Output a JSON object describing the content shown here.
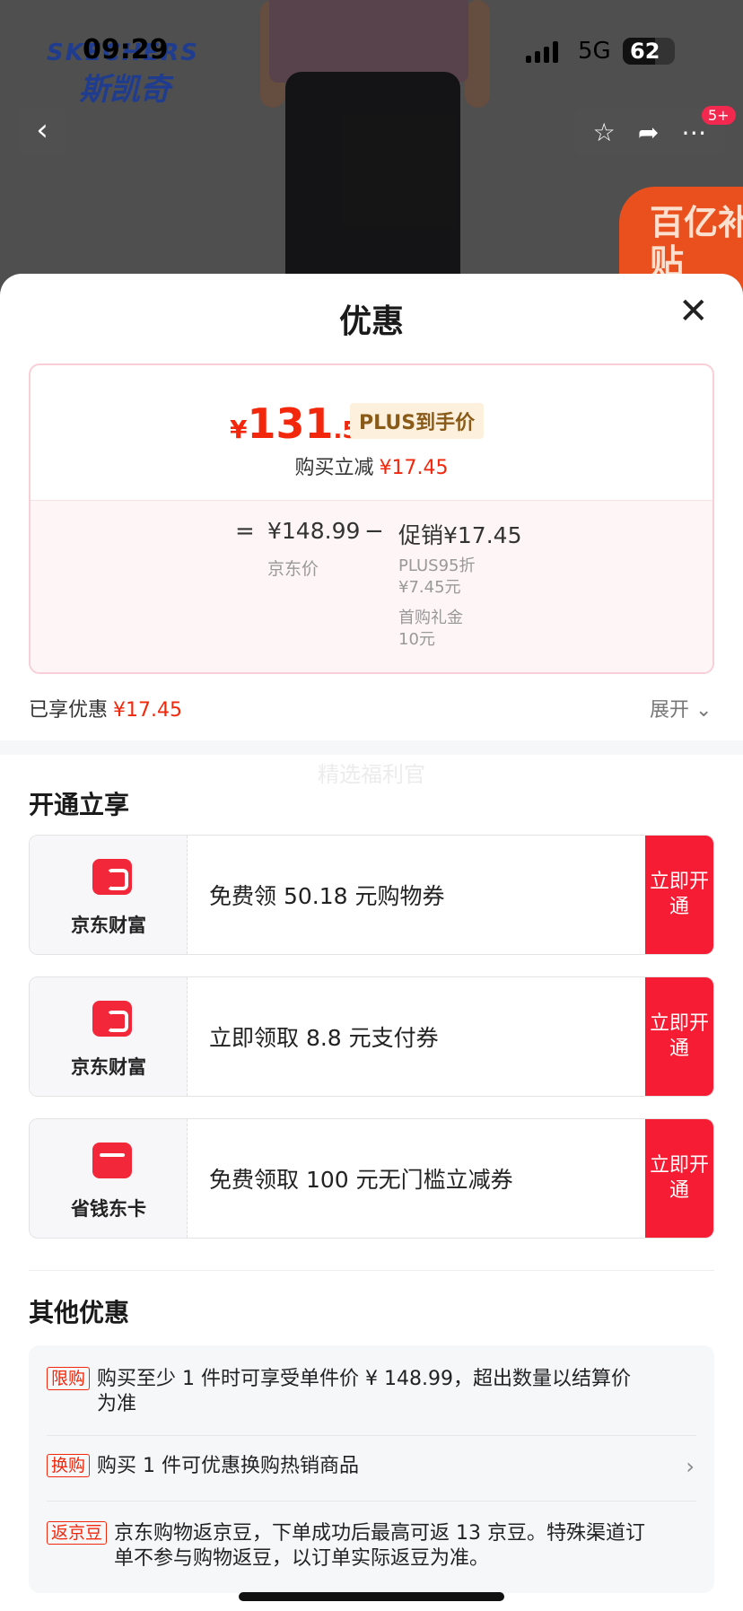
{
  "status_bar": {
    "time": "09:29",
    "network": "5G",
    "battery": "62"
  },
  "brand": {
    "en": "SKECHERS",
    "cn": "斯凯奇"
  },
  "header": {
    "cart_badge": "5+",
    "subsidy_text": "百亿补贴"
  },
  "sheet": {
    "title": "优惠"
  },
  "price_card": {
    "currency": "¥",
    "final_int": "131",
    "final_dec": ".54",
    "plus_tag": "PLUS到手价",
    "reduce_label": "购买立减",
    "reduce_value": "¥17.45",
    "eq": "=",
    "jd_price": "¥148.99",
    "jd_label": "京东价",
    "minus": "−",
    "promo": "促销¥17.45",
    "promo_detail_1a": "PLUS95折",
    "promo_detail_1b": "¥7.45元",
    "promo_detail_2a": "首购礼金",
    "promo_detail_2b": "10元"
  },
  "enjoyed": {
    "label": "已享优惠",
    "value": "¥17.45",
    "expand": "展开"
  },
  "watermark": "精选福利官",
  "open_section": {
    "title": "开通立享",
    "offers": [
      {
        "brand": "京东财富",
        "desc": "免费领 50.18 元购物券",
        "button": "立即开通"
      },
      {
        "brand": "京东财富",
        "desc": "立即领取 8.8 元支付券",
        "button": "立即开通"
      },
      {
        "brand": "省钱东卡",
        "desc": "免费领取 100 元无门槛立减券",
        "button": "立即开通"
      }
    ]
  },
  "other_section": {
    "title": "其他优惠",
    "rows": [
      {
        "tag": "限购",
        "text_1": "购买至少 1 件时可享受单件价 ¥ 148.99，超出数量以结算价",
        "text_2": "为准"
      },
      {
        "tag": "换购",
        "text_1": "购买 1 件可优惠换购热销商品"
      },
      {
        "tag": "返京豆",
        "text_1": "京东购物返京豆，下单成功后最高可返 13 京豆。特殊渠道订",
        "text_2": "单不参与购物返豆，以订单实际返豆为准。"
      }
    ]
  },
  "colors": {
    "accent_red": "#f2270c",
    "button_red": "#f51c33",
    "plus_tag_bg": "#fdf0dc"
  }
}
